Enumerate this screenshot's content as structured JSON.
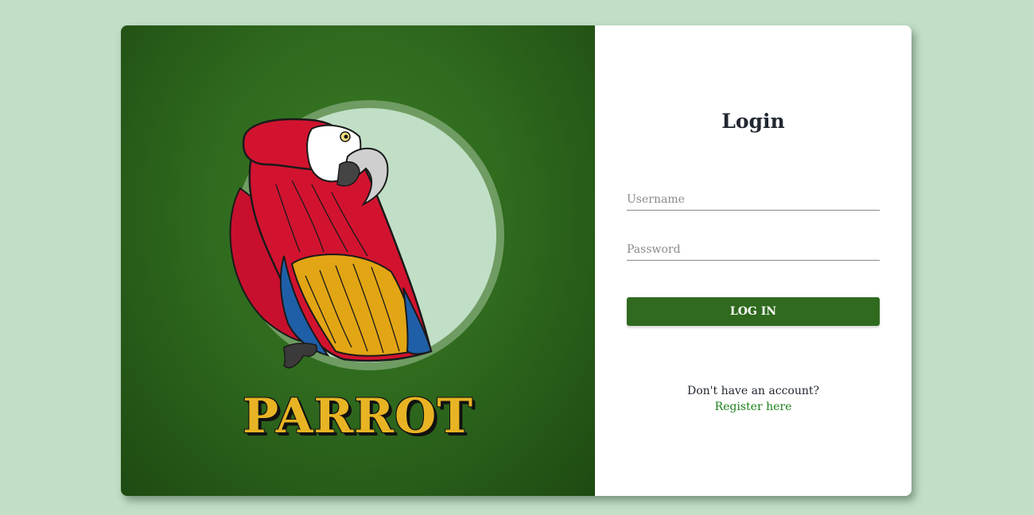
{
  "brand": {
    "title": "PARROT",
    "logo_icon": "parrot-icon",
    "panel_color": "#2f6a1e",
    "title_color": "#e8b424"
  },
  "login": {
    "heading": "Login",
    "username_placeholder": "Username",
    "password_placeholder": "Password",
    "submit_label": "LOG IN",
    "register_prompt": "Don't have an account?",
    "register_link": "Register here",
    "accent_color": "#2f6a1e",
    "link_color": "#1a7f1a"
  }
}
